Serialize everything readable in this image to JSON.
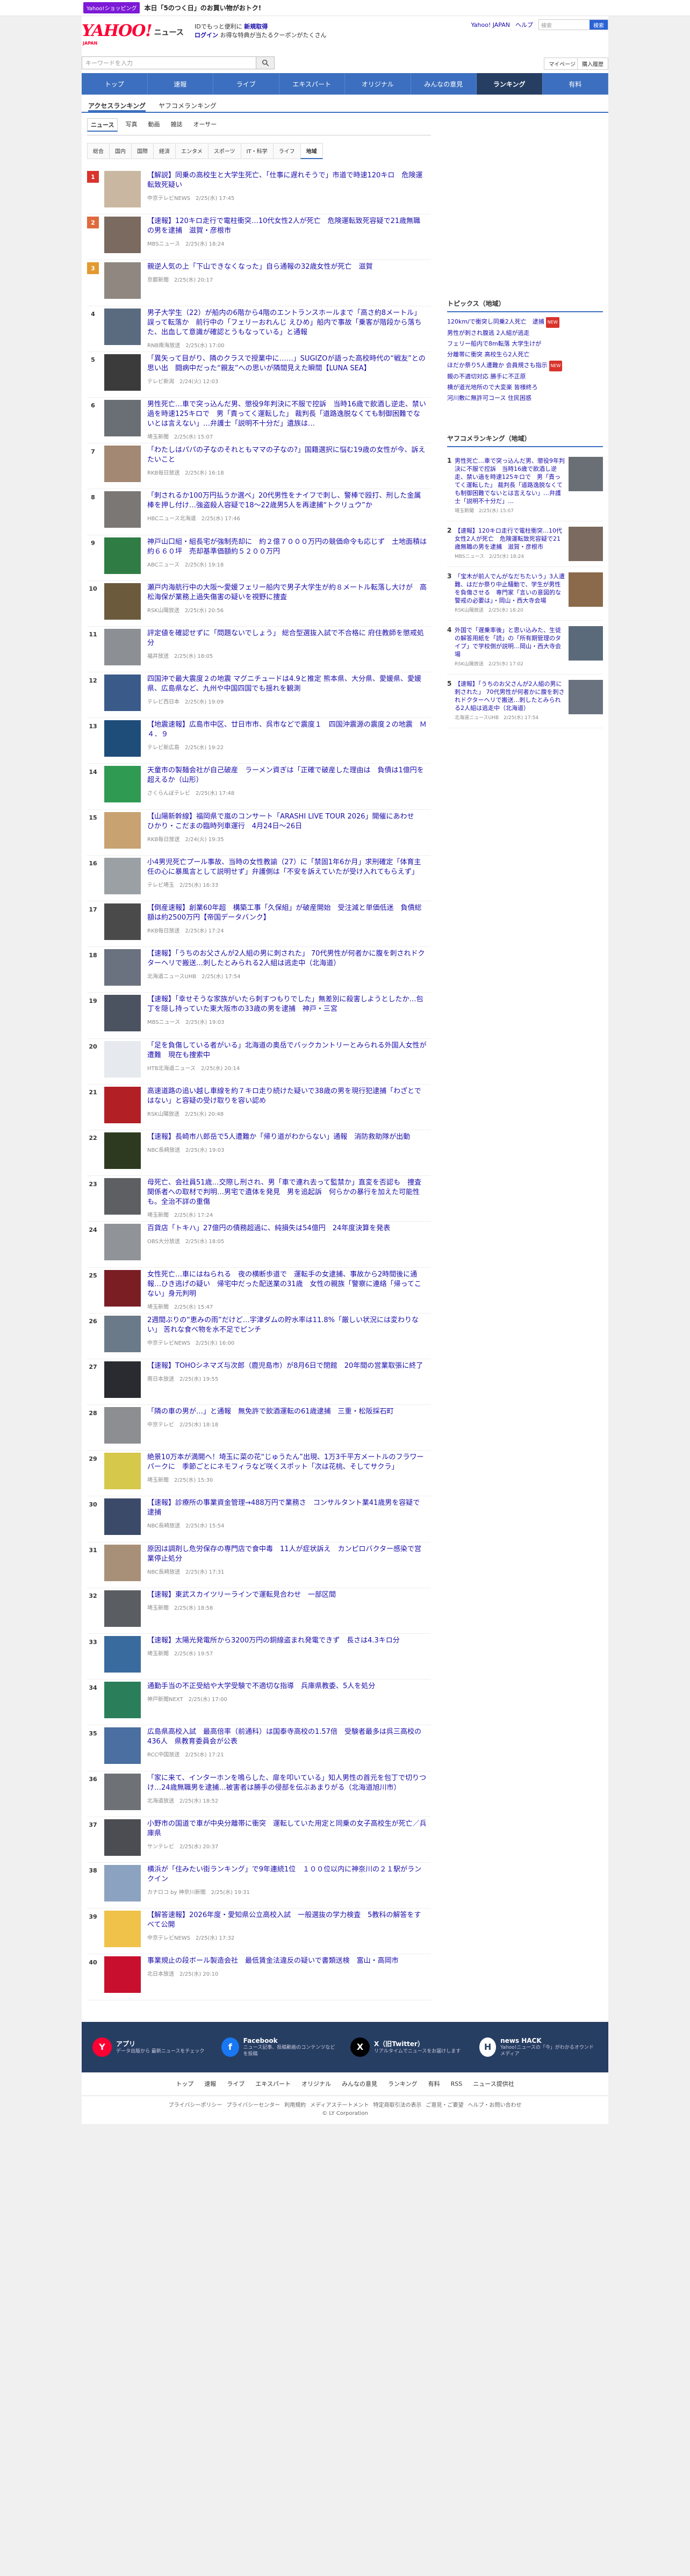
{
  "promo": {
    "tag": "Yahoo!ショッピング",
    "text": "本日「5のつく日」のお買い物がおトク!"
  },
  "header": {
    "logo_main": "YAHOO!",
    "logo_sub": "ニュース",
    "logo_japan": "JAPAN",
    "tagline1": "IDでもっと便利に",
    "tagline1_link": "新規取得",
    "tagline2_login": "ログイン",
    "tagline2_text": "お得な特典が当たるクーポンがたくさん",
    "right_links": [
      "Yahoo! JAPAN",
      "ヘルプ"
    ],
    "search_placeholder": "検索",
    "search_btn": "検索"
  },
  "searchbar": {
    "placeholder": "キーワードを入力",
    "mypage": "マイページ",
    "buy": "購入履歴"
  },
  "nav": [
    {
      "label": "トップ",
      "active": false
    },
    {
      "label": "速報",
      "active": false
    },
    {
      "label": "ライブ",
      "active": false
    },
    {
      "label": "エキスパート",
      "active": false
    },
    {
      "label": "オリジナル",
      "active": false
    },
    {
      "label": "みんなの意見",
      "active": false
    },
    {
      "label": "ランキング",
      "active": true
    },
    {
      "label": "有料",
      "active": false
    }
  ],
  "subtabs": [
    {
      "label": "アクセスランキング",
      "active": true
    },
    {
      "label": "ヤフコメランキング",
      "active": false
    }
  ],
  "cattabs": [
    {
      "label": "ニュース",
      "active": true
    },
    {
      "label": "写真",
      "active": false
    },
    {
      "label": "動画",
      "active": false
    },
    {
      "label": "雑誌",
      "active": false
    },
    {
      "label": "オーサー",
      "active": false
    }
  ],
  "subcats": [
    {
      "label": "総合",
      "active": false
    },
    {
      "label": "国内",
      "active": false
    },
    {
      "label": "国際",
      "active": false
    },
    {
      "label": "経済",
      "active": false
    },
    {
      "label": "エンタメ",
      "active": false
    },
    {
      "label": "スポーツ",
      "active": false
    },
    {
      "label": "IT・科学",
      "active": false
    },
    {
      "label": "ライフ",
      "active": false
    },
    {
      "label": "地域",
      "active": true
    }
  ],
  "ranking": [
    {
      "n": "1",
      "title": "【解説】同乗の高校生と大学生死亡、「仕事に遅れそうで」市道で時速120キロ　危険運転致死疑い",
      "meta": "中京テレビNEWS　2/25(水) 17:45",
      "color": "#c9b7a1"
    },
    {
      "n": "2",
      "title": "【速報】120キロ走行で電柱衝突…10代女性2人が死亡　危険運転致死容疑で21歳無職の男を逮捕　滋賀・彦根市",
      "meta": "MBSニュース　2/25(水) 18:24",
      "color": "#7a6a5f"
    },
    {
      "n": "3",
      "title": "親逆人気の上「下山できなくなった」自ら通報の32歳女性が死亡　滋賀",
      "meta": "京都新聞　2/25(水) 20:17",
      "color": "#8f8780"
    },
    {
      "n": "4",
      "title": "男子大学生（22）が船内の6階から4階のエントランスホールまで「高さ約8メートル」誤って転落か　前行中の「フェリーおれんじ えひめ」船内で事故「乗客が階段から落ちた、出血して意識が確認とうもなっている」と通報",
      "meta": "RNB南海放送　2/25(水) 17:00",
      "color": "#5a6b80"
    },
    {
      "n": "5",
      "title": "「異矢って目がり、隣のクラスで授業中に……」SUGIZOが語った高校時代の“戦友”との思い出　闘病中だった“親友”への思いが隣間見えた瞬間【LUNA SEA】",
      "meta": "テレビ新潟　2/24(火) 12:03",
      "color": "#3b3b3b"
    },
    {
      "n": "6",
      "title": "男性死亡…車で突っ込んだ男、懲役9年判決に不服で控訴　当時16歳で飲酒し逆走、禁い過を時速125キロで　男「責ってく運転した」 裁判長「道路逸脱なくても制御困難でないとは言えない」…弁護士「説明不十分だ」遺族は…",
      "meta": "埼玉新聞　2/25(水) 15:07",
      "color": "#6a6f76"
    },
    {
      "n": "7",
      "title": "「わたしはパパの子なのそれともママの子なの?」国籍選択に悩む19歳の女性が今、訴えたいこと",
      "meta": "RKB毎日放送　2/25(水) 16:18",
      "color": "#a38873"
    },
    {
      "n": "8",
      "title": "「刺されるか100万円払うか選べ」20代男性をナイフで刺し、警棒で殴打、刑した金属棒を押し付け…強盗殺人容疑で18〜22歳男5人を再逮捕“トクリュウ”か",
      "meta": "HBCニュース北海道　2/25(水) 17:46",
      "color": "#7b7775"
    },
    {
      "n": "9",
      "title": "神戸山口組・組長宅が強制売却に　約２億７０００万円の競価命令も応じず　土地面積は約６６０坪　売却基準価額約５２００万円",
      "meta": "ABCニュース　2/25(水) 19:18",
      "color": "#2f7d44"
    },
    {
      "n": "10",
      "title": "瀬戸内海航行中の大阪〜愛媛フェリー船内で男子大学生が約８メートル転落し大けが　高松海保が業務上過失傷害の疑いを視野に捜査",
      "meta": "RSK山陽放送　2/25(水) 20:56",
      "color": "#6b5b3c"
    },
    {
      "n": "11",
      "title": "評定値を確認せずに「問題ないでしょう」 総合型選抜入試で不合格に 府住教師を懲戒処分",
      "meta": "福井放送　2/25(水) 18:05",
      "color": "#8c8f93"
    },
    {
      "n": "12",
      "title": "四国沖で最大震度２の地震 マグニチュードは4.9と推定 熊本県、大分県、愛媛県、愛媛県、広島県など、九州や中国四国でも揺れを観測",
      "meta": "テレビ西日本　2/25(水) 19:09",
      "color": "#3a5a8a"
    },
    {
      "n": "13",
      "title": "【地震速報】広島市中区、廿日市市、呉市などで震度１　四国沖震源の震度２の地震　Ｍ４．９",
      "meta": "テレビ新広島　2/25(水) 19:22",
      "color": "#1f4d7a"
    },
    {
      "n": "14",
      "title": "天童市の製麺会社が自己破産　ラーメン資ぎは「正確で破産した理由は　負債は1億円を超えるか（山形）",
      "meta": "さくらんぼテレビ　2/25(水) 17:48",
      "color": "#2f9a51"
    },
    {
      "n": "15",
      "title": "【山陽新幹線】福岡県で嵐のコンサート「ARASHI LIVE TOUR 2026」開催にあわせ　ひかり・こだまの臨時列車運行　4月24日〜26日",
      "meta": "RKB毎日放送　2/24(火) 19:35",
      "color": "#c8a270"
    },
    {
      "n": "16",
      "title": "小4男児死亡プール事故、当時の女性教諭（27）に「禁固1年6か月」求刑確定「体育主任の心に暴風言として説明せず」弁護側は「不安を訴えていたが受け入れてもらえず」",
      "meta": "テレビ埼玉　2/25(水) 16:33",
      "color": "#9aa0a4"
    },
    {
      "n": "17",
      "title": "【倒産速報】創業60年超　構築工事「久保組」が破産開始　受注減と単価低迷　負債総額は約2500万円【帝国データバンク】",
      "meta": "RKB毎日放送　2/25(水) 17:24",
      "color": "#4a4a4a"
    },
    {
      "n": "18",
      "title": "【速報】「うちのお父さんが2人組の男に刺された」 70代男性が何者かに腹を刺されドクターヘリで搬送…刺したとみられる2人組は逃走中（北海道）",
      "meta": "北海道ニュースUHB　2/25(水) 17:54",
      "color": "#6a7280"
    },
    {
      "n": "19",
      "title": "【速報】「幸せそうな家族がいたら刺すつもりでした」無差別に殺害しようとしたか…包丁を隠し持っていた東大阪市の33歳の男を逮捕　神戸・三宮",
      "meta": "MBSニュース　2/25(水) 19:03",
      "color": "#4b5260"
    },
    {
      "n": "20",
      "title": "「足を負傷している者がいる」北海道の奥岳でバックカントリーとみられる外国人女性が遭難　現在も捜索中",
      "meta": "HTB北海道ニュース　2/25(水) 20:14",
      "color": "#e6e9ee"
    },
    {
      "n": "21",
      "title": "高速道路の追い越し車線を約７キロ走り続けた疑いで38歳の男を現行犯逮捕「わざとではない」と容疑の受け取りを容い認め",
      "meta": "RSK山陽放送　2/25(水) 20:48",
      "color": "#b21f25"
    },
    {
      "n": "22",
      "title": "【速報】長崎市八郎岳で5人遭難か「帰り道がわからない」通報　消防救助隊が出動",
      "meta": "NBC長崎放送　2/25(水) 19:03",
      "color": "#2d3a1f"
    },
    {
      "n": "23",
      "title": "母死亡、会社員51歳…交際し刑され、男「車で連れ去って監禁か」直変を否認も　捜査関係者への取材で判明…男宅で遺体を発見　男を追起訴　何らかの暴行を加えた可能性も。全治不詳の重傷",
      "meta": "埼玉新聞　2/25(水) 17:24",
      "color": "#5d5f63"
    },
    {
      "n": "24",
      "title": "百貨店「トキハ」27億円の債務超過に、純損失は54億円　24年度決算を発表",
      "meta": "OBS大分放送　2/25(水) 18:05",
      "color": "#909398"
    },
    {
      "n": "25",
      "title": "女性死亡…車にはねられる　夜の横断歩道で　運転手の女逮捕、事故から2時間後に通報…ひき逃げの疑い　帰宅中だった配送業の31歳　女性の親族「警察に連絡「帰ってこない」身元判明",
      "meta": "埼玉新聞　2/25(水) 15:47",
      "color": "#7a1e24"
    },
    {
      "n": "26",
      "title": "2週間ぶりの“恵みの雨”だけど…宇津ダムの貯水率は11.8%「厳しい状況には変わりない」 苦れな食べ物を水不足でピンチ",
      "meta": "中京テレビNEWS　2/25(水) 16:00",
      "color": "#6b7a88"
    },
    {
      "n": "27",
      "title": "【速報】TOHOシネマズ与次郎（鹿児島市）が8月6日で閉館　20年間の営業取張に終了",
      "meta": "南日本放送　2/25(水) 19:55",
      "color": "#2a2b30"
    },
    {
      "n": "28",
      "title": "「隣の車の男が…」と通報　無免許で飲酒運転の61歳逮捕　三重・松阪採石町",
      "meta": "中京テレビ　2/25(水) 18:18",
      "color": "#8c8e92"
    },
    {
      "n": "29",
      "title": "絶景10万本が満開へ！埼玉に菜の花“じゅうたん”出現、1万3千平方メートルのフラワーパークに　季節ごとにネモフィラなど咲くスポット「次は花桃、そしてサクラ」",
      "meta": "埼玉新聞　2/25(水) 15:30",
      "color": "#d6c84a"
    },
    {
      "n": "30",
      "title": "【速報】診療所の事業資金管理→488万円で業務さ　コンサルタント業41歳男を容疑で逮捕",
      "meta": "NBC長崎放送　2/25(水) 15:54",
      "color": "#3c4a6a"
    },
    {
      "n": "31",
      "title": "原因は調剤し危労保存の専門店で食中毒　11人が症状訴え　カンピロバクター感染で営業停止処分",
      "meta": "NBC長崎放送　2/25(水) 17:31",
      "color": "#a89078"
    },
    {
      "n": "32",
      "title": "【速報】東武スカイツリーラインで運転見合わせ　一部区間",
      "meta": "埼玉新聞　2/25(水) 18:58",
      "color": "#5a5d62"
    },
    {
      "n": "33",
      "title": "【速報】太陽光発電所から3200万円の銅線盗まれ発電できず　長さは4.3キロ分",
      "meta": "埼玉新聞　2/25(水) 19:57",
      "color": "#3a6b9e"
    },
    {
      "n": "34",
      "title": "通勤手当の不正受給や大学受験で不適切な指導　兵庫県教委、5人を処分",
      "meta": "神戸新聞NEXT　2/25(水) 17:00",
      "color": "#2a7f5a"
    },
    {
      "n": "35",
      "title": "広島県高校入試　最高倍率（前通科）は国泰寺高校の1.57倍　受験者最多は呉三高校の436人　県教育委員会が公表",
      "meta": "RCC中国放送　2/25(水) 17:21",
      "color": "#4a6fa0"
    },
    {
      "n": "36",
      "title": "「家に来て、インターホンを鳴らした、扉を叩いている」知人男性の首元を包丁で切りつけ…24歳無職男を逮捕…被害者は勝手の侵部を伝ぶあまりがる（北海道旭川市）",
      "meta": "北海道放送　2/25(水) 18:52",
      "color": "#6e7176"
    },
    {
      "n": "37",
      "title": "小野市の国道で車が中央分離帯に衝突　運転していた用定と同乗の女子高校生が死亡／兵庫県",
      "meta": "サンテレビ　2/25(水) 20:37",
      "color": "#4b4d52"
    },
    {
      "n": "38",
      "title": "横浜が「住みたい街ランキング」で9年連続1位　１００位以内に神奈川の２１駅がランクイン",
      "meta": "カナロコ by 神奈川新聞　2/25(水) 19:31",
      "color": "#8ba3c0"
    },
    {
      "n": "39",
      "title": "【解答速報】2026年度・愛知県公立高校入試　一般選抜の学力検査　5教科の解答をすべて公開",
      "meta": "中京テレビNEWS　2/25(水) 17:32",
      "color": "#f0c24a"
    },
    {
      "n": "40",
      "title": "事業規止の段ボール製造会社　最低賃金法違反の疑いで書類送検　富山・高岡市",
      "meta": "北日本放送　2/25(水) 20:10",
      "color": "#c8102e"
    }
  ],
  "topics": {
    "title": "トピックス（地域）",
    "items": [
      {
        "text": "120km/で衝突し同乗2人死亡　逮捕",
        "badge": "NEW"
      },
      {
        "text": "男性が刺され腹逃 2人組が逃走",
        "badge": ""
      },
      {
        "text": "フェリー船内で8m転落 大学生けが",
        "badge": ""
      },
      {
        "text": "分離帯に衝突 高校生ら2人死亡",
        "badge": ""
      },
      {
        "text": "ほだか祭り5人遭難か 会員規さも指示",
        "badge": "NEW"
      },
      {
        "text": "親の不適切対応 勝手に不正原",
        "badge": ""
      },
      {
        "text": "横が道光地所ので大変楽 皆様終ろ",
        "badge": ""
      },
      {
        "text": "河川敷に無許可コース 住民困惑",
        "badge": ""
      }
    ]
  },
  "yahoocomment": {
    "title": "ヤフコメランキング（地域）",
    "items": [
      {
        "n": "1",
        "text": "男性死亡…車で突っ込んだ男、懲役9年判決に不服で控訴　当時16歳で飲酒し逆走、禁い過を時速125キロで　男「責ってく運転した」 裁判長「道路逸脱なくても制御困難でないとは言えない」…弁護士「説明不十分だ」…",
        "meta": "埼玉新聞　2/25(水) 15:07",
        "color": "#6a6f76"
      },
      {
        "n": "2",
        "text": "【速報】120キロ走行で電柱衝突…10代女性2人が死亡　危険運転致死容疑で21歳無職の男を逮捕　滋賀・彦根市",
        "meta": "MBSニュース　2/25(水) 18:24",
        "color": "#7a6a5f"
      },
      {
        "n": "3",
        "text": "「宝木が前人でんがなだちたいう」3人遭難、はだか祭り中止騒動で、学生が男性を負傷させる　専門家「言いの意図的な警戒の必要は」・岡山・西大寺会場",
        "meta": "RSK山陽放送　2/25(水) 18:20",
        "color": "#8a6a4a"
      },
      {
        "n": "4",
        "text": "外国で「遅乗率後」と思い込みた、生徒の解答用紙を「読」の「所有期管理のタイプ」で学校側が説明…岡山・西大寺会場",
        "meta": "RSK山陽放送　2/25(水) 17:02",
        "color": "#5a6a7a"
      },
      {
        "n": "5",
        "text": "【速報】「うちのお父さんが2人組の男に刺された」 70代男性が何者かに腹を刺されドクターヘリで搬送…刺したとみられる2人組は逃走中（北海道）",
        "meta": "北海道ニュースUHB　2/25(水) 17:54",
        "color": "#6a7280"
      }
    ]
  },
  "footer": {
    "apps": [
      {
        "title": "アプリ",
        "desc": "データ出版から 最新ニュースをチェック",
        "icon": "Y",
        "color": "#ff0033"
      },
      {
        "title": "Facebook",
        "desc": "ニュース記事、投稿動画のコンテンツなどを投稿",
        "icon": "f",
        "color": "#1877f2"
      },
      {
        "title": "X（旧Twitter）",
        "desc": "リアルタイムでニュースをお届けします",
        "icon": "X",
        "color": "#000000"
      },
      {
        "title": "news HACK",
        "desc": "Yahoo!ニュースの「今」がわかるオウンドメディア",
        "icon": "H",
        "color": "#ffffff"
      }
    ],
    "nav": [
      "トップ",
      "速報",
      "ライブ",
      "エキスパート",
      "オリジナル",
      "みんなの意見",
      "ランキング",
      "有料",
      "RSS",
      "ニュース提供社"
    ],
    "legal": [
      "プライバシーポリシー",
      "プライバシーセンター",
      "利用規約",
      "メディアステートメント",
      "特定商取引法の表示",
      "ご意見・ご要望",
      "ヘルプ・お問い合わせ"
    ],
    "copyright": "© LY Corporation"
  }
}
